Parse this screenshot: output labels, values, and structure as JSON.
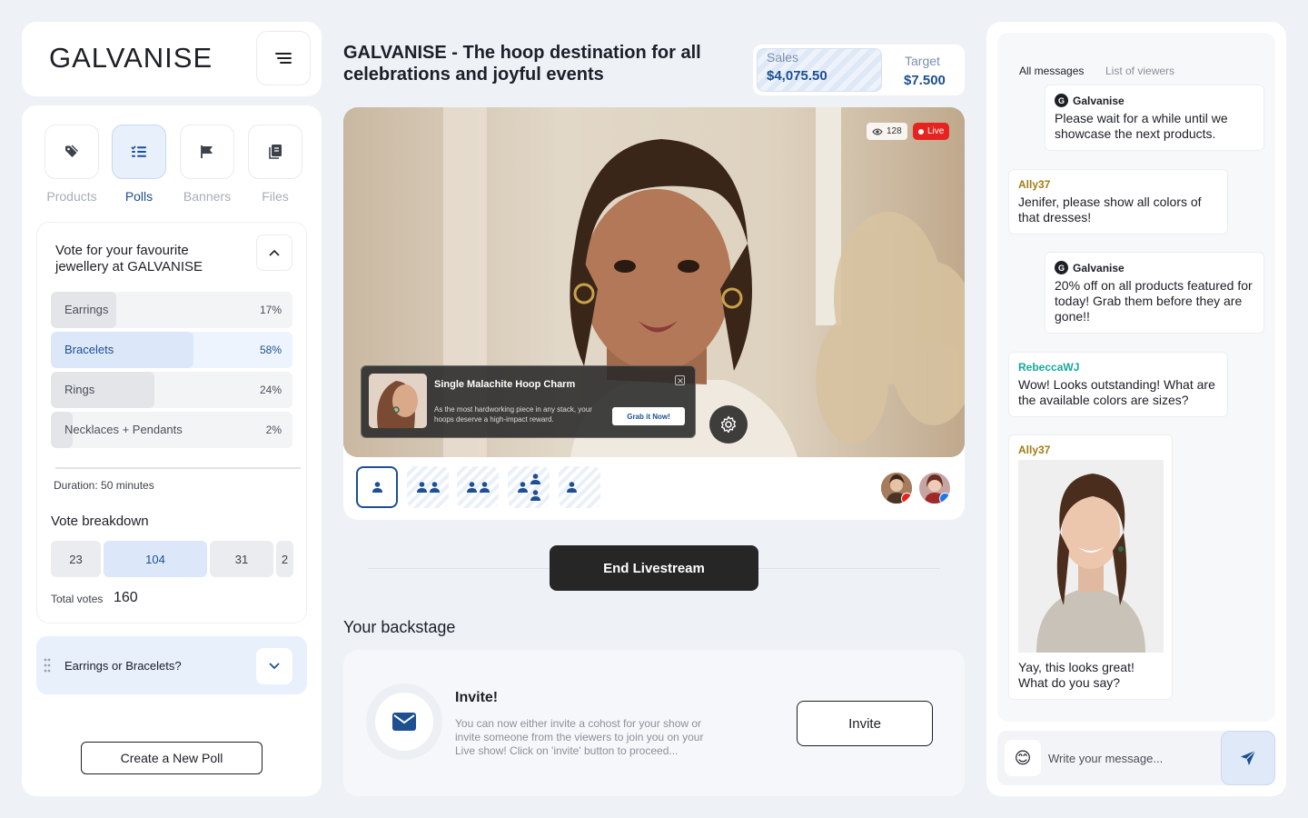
{
  "brand": {
    "name": "GALVANISE"
  },
  "tools": [
    {
      "label": "Products",
      "icon": "tag-icon"
    },
    {
      "label": "Polls",
      "icon": "poll-list-icon",
      "active": true
    },
    {
      "label": "Banners",
      "icon": "flag-icon"
    },
    {
      "label": "Files",
      "icon": "files-icon"
    }
  ],
  "poll": {
    "question": "Vote for your favourite jewellery at GALVANISE",
    "options": [
      {
        "name": "Earrings",
        "percent": "17%",
        "fraction": 0.27
      },
      {
        "name": "Bracelets",
        "percent": "58%",
        "fraction": 0.59,
        "selected": true
      },
      {
        "name": "Rings",
        "percent": "24%",
        "fraction": 0.43
      },
      {
        "name": "Necklaces + Pendants",
        "percent": "2%",
        "fraction": 0.09
      }
    ],
    "duration": "Duration: 50 minutes",
    "breakdown_title": "Vote breakdown",
    "breakdown": [
      "23",
      "104",
      "31",
      "2"
    ],
    "total_label": "Total votes",
    "total_value": "160"
  },
  "poll2": {
    "label": "Earrings or Bracelets?"
  },
  "create_poll_label": "Create a New Poll",
  "stream": {
    "title": "GALVANISE - The hoop destination for all celebrations and joyful events",
    "sales_label": "Sales",
    "sales_value": "$4,075.50",
    "target_label": "Target",
    "target_value": "$7.500",
    "viewers": "128",
    "live_label": "Live"
  },
  "product_popup": {
    "title": "Single Malachite Hoop Charm",
    "description": "As the most hardworking piece in any stack, your hoops deserve a high-impact reward.",
    "cta": "Grab it Now!"
  },
  "end_livestream_label": "End Livestream",
  "backstage": {
    "title": "Your backstage",
    "invite_title": "Invite!",
    "invite_desc": "You can now either invite a cohost for your show or invite someone from the viewers to join you on your Live show! Click on 'invite' button to proceed...",
    "invite_button": "Invite"
  },
  "chat": {
    "tabs": [
      "All messages",
      "List of viewers"
    ],
    "messages": [
      {
        "author": "Galvanise",
        "text": "Please wait for a while until we showcase the next products.",
        "color": "#1c1f26"
      },
      {
        "author": "Ally37",
        "text": "Jenifer, please show all colors of that dresses!",
        "color": "#a17d12"
      },
      {
        "author": "Galvanise",
        "text": "20% off on all products featured for today! Grab them before they are gone!!",
        "color": "#1c1f26"
      },
      {
        "author": "RebeccaWJ",
        "text": "Wow! Looks outstanding! What are the available colors are sizes?",
        "color": "#17a89a"
      },
      {
        "author": "Ally37",
        "text": "Yay, this looks great! What do you say?",
        "color": "#a17d12"
      }
    ],
    "input_placeholder": "Write your message..."
  },
  "colors": {
    "accent": "#1d4f91",
    "live": "#e52420",
    "dark_button": "#262626"
  }
}
